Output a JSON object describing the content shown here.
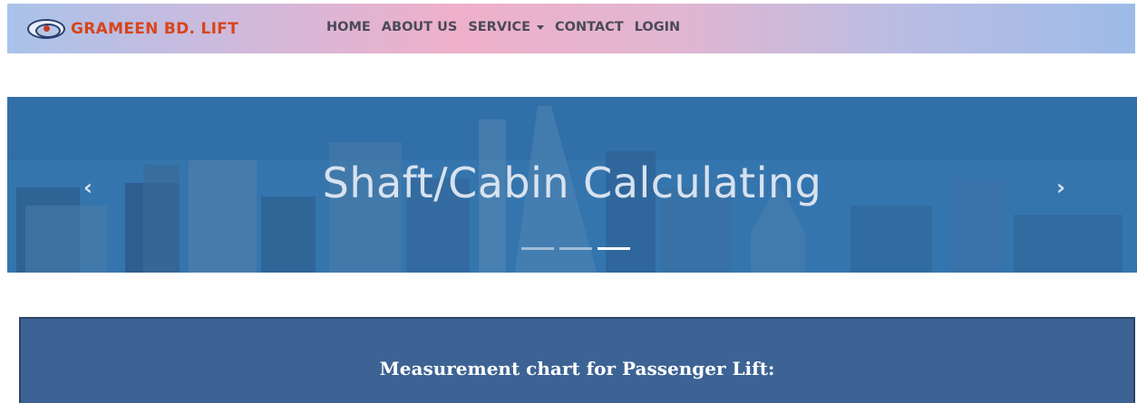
{
  "navbar": {
    "brand": "GRAMEEN BD. LIFT",
    "links": [
      "HOME",
      "ABOUT US",
      "SERVICE",
      "CONTACT",
      "LOGIN"
    ]
  },
  "hero": {
    "caption": "Shaft/Cabin Calculating",
    "prev_icon": "chevron-left-icon",
    "next_icon": "chevron-right-icon",
    "slide_count": 3,
    "active_slide": 3
  },
  "panel": {
    "title": "Measurement chart for Passenger Lift:"
  },
  "colors": {
    "brand": "#d84519",
    "nav_text": "#4a4a58",
    "hero_blue": "#3a7bb3",
    "panel_blue": "#3c6394"
  }
}
